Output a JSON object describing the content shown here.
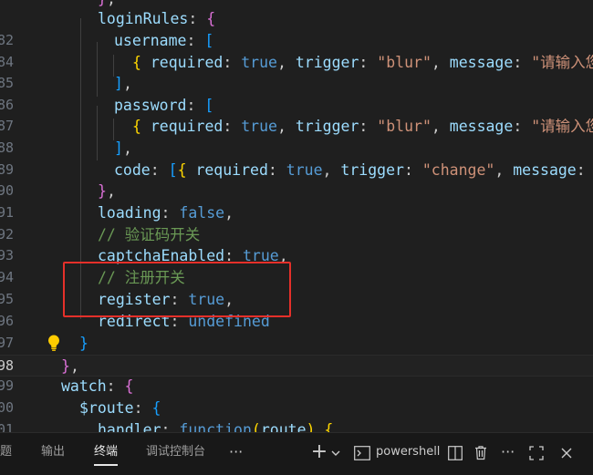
{
  "editor": {
    "lines": [
      {
        "num": "",
        "tokens": [
          {
            "t": "}",
            "c": "p2"
          },
          {
            "t": ",",
            "c": "w"
          }
        ]
      },
      {
        "num": "",
        "tokens": [
          {
            "t": "loginRules",
            "c": "k"
          },
          {
            "t": ": ",
            "c": "w"
          },
          {
            "t": "{",
            "c": "p2"
          }
        ]
      },
      {
        "num": "82",
        "tokens": [
          {
            "t": "username",
            "c": "k"
          },
          {
            "t": ": ",
            "c": "w"
          },
          {
            "t": "[",
            "c": "p3"
          }
        ]
      },
      {
        "num": "84",
        "tokens": [
          {
            "t": "{",
            "c": "p1"
          },
          {
            "t": " ",
            "c": "w"
          },
          {
            "t": "required",
            "c": "k"
          },
          {
            "t": ": ",
            "c": "w"
          },
          {
            "t": "true",
            "c": "b"
          },
          {
            "t": ", ",
            "c": "w"
          },
          {
            "t": "trigger",
            "c": "k"
          },
          {
            "t": ": ",
            "c": "w"
          },
          {
            "t": "\"blur\"",
            "c": "s"
          },
          {
            "t": ", ",
            "c": "w"
          },
          {
            "t": "message",
            "c": "k"
          },
          {
            "t": ": ",
            "c": "w"
          },
          {
            "t": "\"请输入您",
            "c": "s"
          }
        ]
      },
      {
        "num": "85",
        "tokens": [
          {
            "t": "]",
            "c": "p3"
          },
          {
            "t": ",",
            "c": "w"
          }
        ]
      },
      {
        "num": "86",
        "tokens": [
          {
            "t": "password",
            "c": "k"
          },
          {
            "t": ": ",
            "c": "w"
          },
          {
            "t": "[",
            "c": "p3"
          }
        ]
      },
      {
        "num": "87",
        "tokens": [
          {
            "t": "{",
            "c": "p1"
          },
          {
            "t": " ",
            "c": "w"
          },
          {
            "t": "required",
            "c": "k"
          },
          {
            "t": ": ",
            "c": "w"
          },
          {
            "t": "true",
            "c": "b"
          },
          {
            "t": ", ",
            "c": "w"
          },
          {
            "t": "trigger",
            "c": "k"
          },
          {
            "t": ": ",
            "c": "w"
          },
          {
            "t": "\"blur\"",
            "c": "s"
          },
          {
            "t": ", ",
            "c": "w"
          },
          {
            "t": "message",
            "c": "k"
          },
          {
            "t": ": ",
            "c": "w"
          },
          {
            "t": "\"请输入您",
            "c": "s"
          }
        ]
      },
      {
        "num": "88",
        "tokens": [
          {
            "t": "]",
            "c": "p3"
          },
          {
            "t": ",",
            "c": "w"
          }
        ]
      },
      {
        "num": "89",
        "tokens": [
          {
            "t": "code",
            "c": "k"
          },
          {
            "t": ": ",
            "c": "w"
          },
          {
            "t": "[",
            "c": "p3"
          },
          {
            "t": "{",
            "c": "p1"
          },
          {
            "t": " ",
            "c": "w"
          },
          {
            "t": "required",
            "c": "k"
          },
          {
            "t": ": ",
            "c": "w"
          },
          {
            "t": "true",
            "c": "b"
          },
          {
            "t": ", ",
            "c": "w"
          },
          {
            "t": "trigger",
            "c": "k"
          },
          {
            "t": ": ",
            "c": "w"
          },
          {
            "t": "\"change\"",
            "c": "s"
          },
          {
            "t": ", ",
            "c": "w"
          },
          {
            "t": "message",
            "c": "k"
          },
          {
            "t": ": ",
            "c": "w"
          },
          {
            "t": "\"讠",
            "c": "s"
          }
        ]
      },
      {
        "num": "90",
        "tokens": [
          {
            "t": "}",
            "c": "p2"
          },
          {
            "t": ",",
            "c": "w"
          }
        ]
      },
      {
        "num": "91",
        "tokens": [
          {
            "t": "loading",
            "c": "k"
          },
          {
            "t": ": ",
            "c": "w"
          },
          {
            "t": "false",
            "c": "b"
          },
          {
            "t": ",",
            "c": "w"
          }
        ]
      },
      {
        "num": "92",
        "tokens": [
          {
            "t": "// 验证码开关",
            "c": "c"
          }
        ]
      },
      {
        "num": "93",
        "tokens": [
          {
            "t": "captchaEnabled",
            "c": "k"
          },
          {
            "t": ": ",
            "c": "w"
          },
          {
            "t": "true",
            "c": "b"
          },
          {
            "t": ",",
            "c": "w"
          }
        ]
      },
      {
        "num": "94",
        "tokens": [
          {
            "t": "// 注册开关",
            "c": "c"
          }
        ]
      },
      {
        "num": "95",
        "tokens": [
          {
            "t": "register",
            "c": "k"
          },
          {
            "t": ": ",
            "c": "w"
          },
          {
            "t": "true",
            "c": "b"
          },
          {
            "t": ",",
            "c": "w"
          }
        ]
      },
      {
        "num": "96",
        "tokens": [
          {
            "t": "redirect",
            "c": "k"
          },
          {
            "t": ": ",
            "c": "w"
          },
          {
            "t": "undefined",
            "c": "b"
          }
        ]
      },
      {
        "num": "97",
        "tokens": [
          {
            "t": "}",
            "c": "p3"
          }
        ]
      },
      {
        "num": "98",
        "tokens": [
          {
            "t": "}",
            "c": "p2"
          },
          {
            "t": ",",
            "c": "w"
          }
        ]
      },
      {
        "num": "99",
        "tokens": [
          {
            "t": "watch",
            "c": "k"
          },
          {
            "t": ": ",
            "c": "w"
          },
          {
            "t": "{",
            "c": "p2"
          }
        ]
      },
      {
        "num": "00",
        "tokens": [
          {
            "t": "$route",
            "c": "k"
          },
          {
            "t": ": ",
            "c": "w"
          },
          {
            "t": "{",
            "c": "p3"
          }
        ]
      },
      {
        "num": "01",
        "tokens": [
          {
            "t": "handler",
            "c": "k"
          },
          {
            "t": ": ",
            "c": "w"
          },
          {
            "t": "function",
            "c": "b"
          },
          {
            "t": "(",
            "c": "p1"
          },
          {
            "t": "route",
            "c": "k"
          },
          {
            "t": ")",
            "c": "p1"
          },
          {
            "t": " ",
            "c": "w"
          },
          {
            "t": "{",
            "c": "p1"
          }
        ]
      }
    ]
  },
  "panel": {
    "tabs": [
      "题",
      "输出",
      "终端",
      "调试控制台"
    ],
    "more": "···",
    "add_icon": "+",
    "dropdown_icon": "chevron-down",
    "shell_label": "powershell",
    "more_actions": "···"
  }
}
